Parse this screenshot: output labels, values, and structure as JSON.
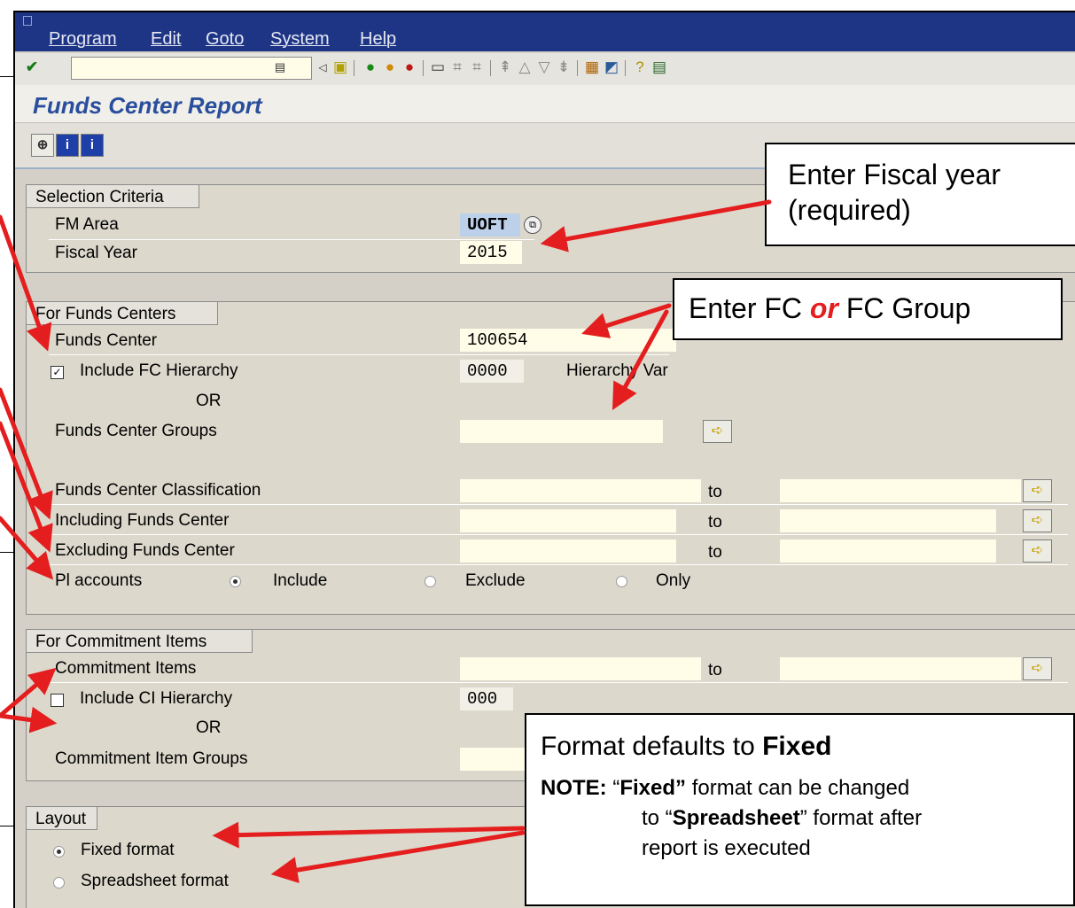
{
  "menu": [
    "Program",
    "Edit",
    "Goto",
    "System",
    "Help"
  ],
  "toolbar_icons": [
    "enter-icon",
    "cmd-dropdown-icon",
    "back-arrow-icon",
    "save-icon",
    "back-icon",
    "exit-icon",
    "cancel-icon",
    "print-icon",
    "find-icon",
    "find-next-icon",
    "first-page-icon",
    "prev-page-icon",
    "next-page-icon",
    "last-page-icon",
    "new-session-icon",
    "shortcut-icon",
    "help-icon",
    "layout-icon"
  ],
  "page_title": "Funds Center Report",
  "app_toolbar_icons": [
    "execute-icon",
    "info-icon",
    "info-icon-2"
  ],
  "selection": {
    "title": "Selection Criteria",
    "fm_area_label": "FM Area",
    "fm_area_value": "UOFT",
    "fiscal_year_label": "Fiscal Year",
    "fiscal_year_value": "2015"
  },
  "funds_centers": {
    "title": "For Funds Centers",
    "funds_center_label": "Funds Center",
    "funds_center_value": "100654",
    "include_fc_label": "Include FC Hierarchy",
    "hierarchy_value": "0000",
    "hierarchy_label": "Hierarchy Var",
    "or_label": "OR",
    "fc_groups_label": "Funds Center Groups",
    "classification_label": "Funds Center Classification",
    "including_label": "Including Funds Center",
    "excluding_label": "Excluding Funds Center",
    "to_label": "to",
    "pl_label": "Pl accounts",
    "pl_include": "Include",
    "pl_exclude": "Exclude",
    "pl_only": "Only"
  },
  "commitment": {
    "title": "For Commitment Items",
    "ci_label": "Commitment Items",
    "include_ci_label": "Include CI Hierarchy",
    "ci_hierarchy_value": "000",
    "or_label": "OR",
    "ci_groups_label": "Commitment Item Groups",
    "to_label": "to"
  },
  "layout_frame": {
    "title": "Layout",
    "fixed_label": "Fixed format",
    "spreadsheet_label": "Spreadsheet format"
  },
  "callouts": {
    "fiscal_line1": "Enter Fiscal year",
    "fiscal_line2": "(required)",
    "fc_pre": "Enter FC ",
    "fc_or": "or",
    "fc_post": "  FC Group",
    "format_pre": "Format defaults to ",
    "format_bold": "Fixed",
    "note_label": "NOTE:",
    "note_q1": " “",
    "note_fixed": "Fixed”",
    "note_mid": " format can be changed",
    "note_to": "to “",
    "note_spread": "Spreadsheet",
    "note_after": "” format after",
    "note_last": "report is executed"
  },
  "colors": {
    "menubar": "#1e3585",
    "title": "#294e9c",
    "arrow": "#e41e1e",
    "field": "#fffde8",
    "or_emphasis": "#e41e1e"
  }
}
